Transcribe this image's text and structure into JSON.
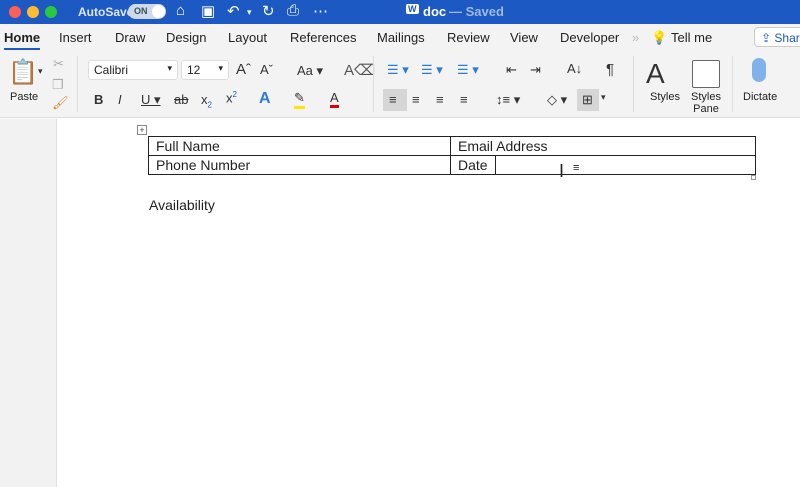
{
  "titlebar": {
    "autosave_label": "AutoSave",
    "autosave_state": "ON",
    "doc_title": "doc",
    "saved_status": "— Saved"
  },
  "tabs": [
    "Home",
    "Insert",
    "Draw",
    "Design",
    "Layout",
    "References",
    "Mailings",
    "Review",
    "View",
    "Developer"
  ],
  "tell_me": "Tell me",
  "share": "Share",
  "ribbon": {
    "paste": "Paste",
    "font": "Calibri",
    "size": "12",
    "styles": "Styles",
    "styles_pane": "Styles Pane",
    "dictate": "Dictate"
  },
  "colors": {
    "titlebar": "#1d59c2",
    "highlight": "#ffe600",
    "font_color": "#e00000"
  },
  "document": {
    "table": [
      [
        "Full Name",
        "Email Address"
      ],
      [
        "Phone Number",
        "Date",
        ""
      ]
    ],
    "paragraph": "Availability"
  }
}
